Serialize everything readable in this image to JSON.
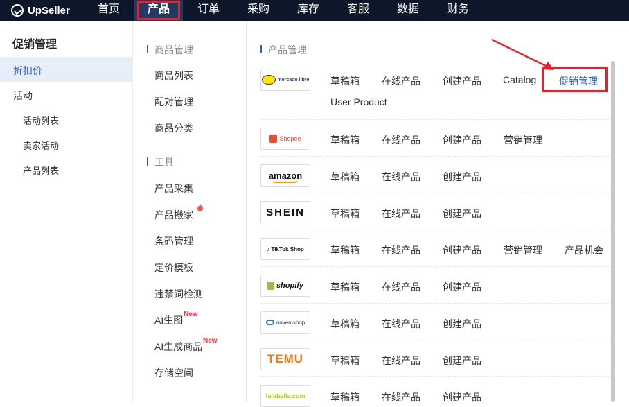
{
  "nav": {
    "logo": "UpSeller",
    "items": [
      "首页",
      "产品",
      "订单",
      "采购",
      "库存",
      "客服",
      "数据",
      "财务"
    ],
    "active": "产品"
  },
  "sidebar": {
    "title": "促销管理",
    "items": [
      "折扣价",
      "活动",
      "活动列表",
      "卖家活动",
      "产品列表"
    ]
  },
  "middle": {
    "section1": "商品管理",
    "section1_items": [
      "商品列表",
      "配对管理",
      "商品分类"
    ],
    "section2": "工具",
    "section2_items": [
      "产品采集",
      "产品搬家",
      "条码管理",
      "定价模板",
      "违禁词检测",
      "AI生图",
      "AI生成商品",
      "存储空间"
    ],
    "new_badge": "New"
  },
  "right": {
    "header": "产品管理",
    "rows": [
      {
        "brand": "mercado libre",
        "links": [
          "草稿箱",
          "在线产品",
          "创建产品",
          "Catalog",
          "促销管理",
          "User Product"
        ]
      },
      {
        "brand": "Shopee",
        "links": [
          "草稿箱",
          "在线产品",
          "创建产品",
          "营销管理"
        ]
      },
      {
        "brand": "amazon",
        "links": [
          "草稿箱",
          "在线产品",
          "创建产品"
        ]
      },
      {
        "brand": "SHEIN",
        "links": [
          "草稿箱",
          "在线产品",
          "创建产品"
        ]
      },
      {
        "brand": "TikTok Shop",
        "links": [
          "草稿箱",
          "在线产品",
          "创建产品",
          "营销管理",
          "产品机会"
        ]
      },
      {
        "brand": "shopify",
        "links": [
          "草稿箱",
          "在线产品",
          "创建产品"
        ]
      },
      {
        "brand": "nuvemshop",
        "links": [
          "草稿箱",
          "在线产品",
          "创建产品"
        ]
      },
      {
        "brand": "TEMU",
        "links": [
          "草稿箱",
          "在线产品",
          "创建产品"
        ]
      },
      {
        "brand": "falabella.com",
        "links": [
          "草稿箱",
          "在线产品",
          "创建产品"
        ]
      }
    ]
  },
  "colors": {
    "nav_bg": "#0e1729",
    "accent_blue": "#2b60d8",
    "highlight_red": "#e8202a"
  }
}
